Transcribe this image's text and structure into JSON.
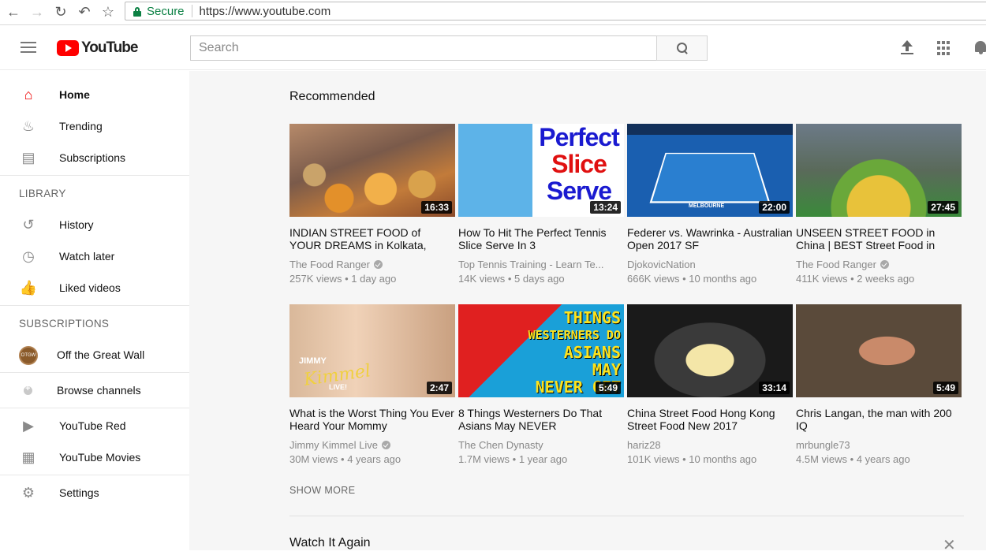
{
  "browser": {
    "secure_label": "Secure",
    "url": "https://www.youtube.com"
  },
  "header": {
    "logo_text": "YouTube",
    "search_placeholder": "Search"
  },
  "sidebar": {
    "main_items": [
      {
        "label": "Home",
        "icon": "home-icon"
      },
      {
        "label": "Trending",
        "icon": "trending-icon"
      },
      {
        "label": "Subscriptions",
        "icon": "subscriptions-icon"
      }
    ],
    "library_heading": "LIBRARY",
    "library_items": [
      {
        "label": "History",
        "icon": "history-icon"
      },
      {
        "label": "Watch later",
        "icon": "watch-later-icon"
      },
      {
        "label": "Liked videos",
        "icon": "liked-videos-icon"
      }
    ],
    "subscriptions_heading": "SUBSCRIPTIONS",
    "subscriptions_items": [
      {
        "label": "Off the Great Wall",
        "icon": "channel-avatar"
      }
    ],
    "browse_channels": "Browse channels",
    "extra_items": [
      {
        "label": "YouTube Red",
        "icon": "youtube-red-icon"
      },
      {
        "label": "YouTube Movies",
        "icon": "youtube-movies-icon"
      }
    ],
    "settings": "Settings"
  },
  "main": {
    "recommended_title": "Recommended",
    "videos": [
      {
        "title": "INDIAN STREET FOOD of YOUR DREAMS in Kolkata,",
        "channel": "The Food Ranger",
        "verified": true,
        "views": "257K views",
        "age": "1 day ago",
        "duration": "16:33"
      },
      {
        "title": "How To Hit The Perfect Tennis Slice Serve In 3",
        "channel": "Top Tennis Training - Learn Te...",
        "verified": false,
        "views": "14K views",
        "age": "5 days ago",
        "duration": "13:24",
        "thumb_text": [
          "Perfect",
          "Slice",
          "Serve"
        ]
      },
      {
        "title": "Federer vs. Wawrinka - Australian Open 2017 SF",
        "channel": "DjokovicNation",
        "verified": false,
        "views": "666K views",
        "age": "10 months ago",
        "duration": "22:00",
        "thumb_text": [
          "MELBOURNE"
        ]
      },
      {
        "title": "UNSEEN STREET FOOD in China | BEST Street Food in",
        "channel": "The Food Ranger",
        "verified": true,
        "views": "411K views",
        "age": "2 weeks ago",
        "duration": "27:45"
      },
      {
        "title": "What is the Worst Thing You Ever Heard Your Mommy",
        "channel": "Jimmy Kimmel Live",
        "verified": true,
        "views": "30M views",
        "age": "4 years ago",
        "duration": "2:47",
        "thumb_text": [
          "JIMMY",
          "Kimmel",
          "LIVE!"
        ]
      },
      {
        "title": "8 Things Westerners Do That Asians May NEVER",
        "channel": "The Chen Dynasty",
        "verified": false,
        "views": "1.7M views",
        "age": "1 year ago",
        "duration": "5:49",
        "thumb_text": [
          "THINGS",
          "WESTERNERS DO",
          "ASIANS MAY",
          "NEVER GET"
        ]
      },
      {
        "title": "China Street Food Hong Kong Street Food New 2017",
        "channel": "hariz28",
        "verified": false,
        "views": "101K views",
        "age": "10 months ago",
        "duration": "33:14"
      },
      {
        "title": "Chris Langan, the man with 200 IQ",
        "channel": "mrbungle73",
        "verified": false,
        "views": "4.5M views",
        "age": "4 years ago",
        "duration": "5:49"
      }
    ],
    "show_more": "SHOW MORE",
    "watch_again_title": "Watch It Again",
    "dismiss_symbol": "✕"
  }
}
